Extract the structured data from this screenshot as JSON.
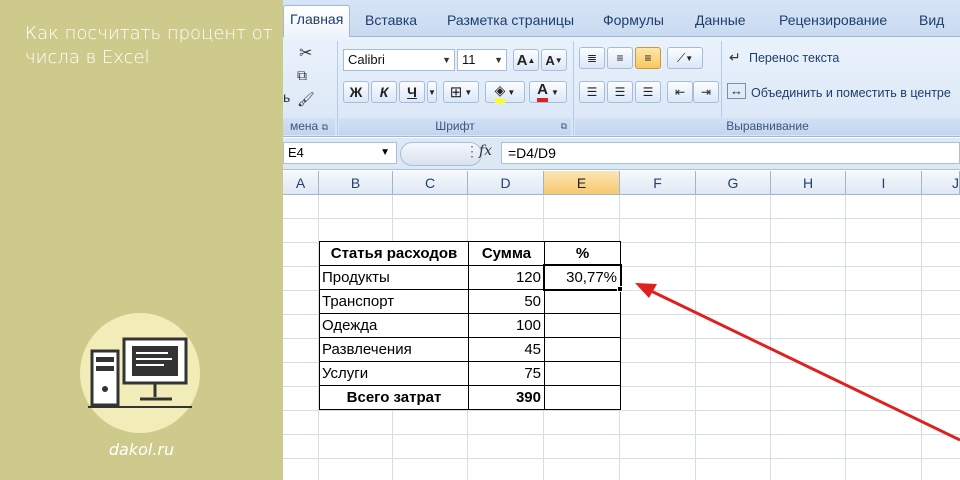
{
  "banner": {
    "title": "Как посчитать процент от числа в Excel",
    "site": "dakol.ru",
    "bg_color": "#cdca8c",
    "logo_icon": "computer-icon"
  },
  "tabs": [
    "Главная",
    "Вставка",
    "Разметка страницы",
    "Формулы",
    "Данные",
    "Рецензирование",
    "Вид"
  ],
  "ribbon": {
    "clipboard_label": "мена",
    "font_group_label": "Шрифт",
    "align_group_label": "Выравнивание",
    "font_name": "Calibri",
    "font_size": "11",
    "bold": "Ж",
    "italic": "К",
    "underline": "Ч",
    "wrap_text": "Перенос текста",
    "merge_center": "Объединить и поместить в центре",
    "grow_font": "A",
    "shrink_font": "A",
    "font_color_letter": "A"
  },
  "formula_bar": {
    "name_box": "E4",
    "fx": "fx",
    "formula": "=D4/D9"
  },
  "columns": [
    "A",
    "B",
    "C",
    "D",
    "E",
    "F",
    "G",
    "H",
    "I",
    "J"
  ],
  "selected_column": "E",
  "table": {
    "headers": [
      "Статья расходов",
      "Сумма",
      "%"
    ],
    "rows": [
      {
        "item": "Продукты",
        "sum": "120",
        "pct": "30,77%"
      },
      {
        "item": "Транспорт",
        "sum": "50",
        "pct": ""
      },
      {
        "item": "Одежда",
        "sum": "100",
        "pct": ""
      },
      {
        "item": "Развлечения",
        "sum": "45",
        "pct": ""
      },
      {
        "item": "Услуги",
        "sum": "75",
        "pct": ""
      }
    ],
    "total_label": "Всего затрат",
    "total_sum": "390"
  },
  "arrow_color": "#e0201e"
}
